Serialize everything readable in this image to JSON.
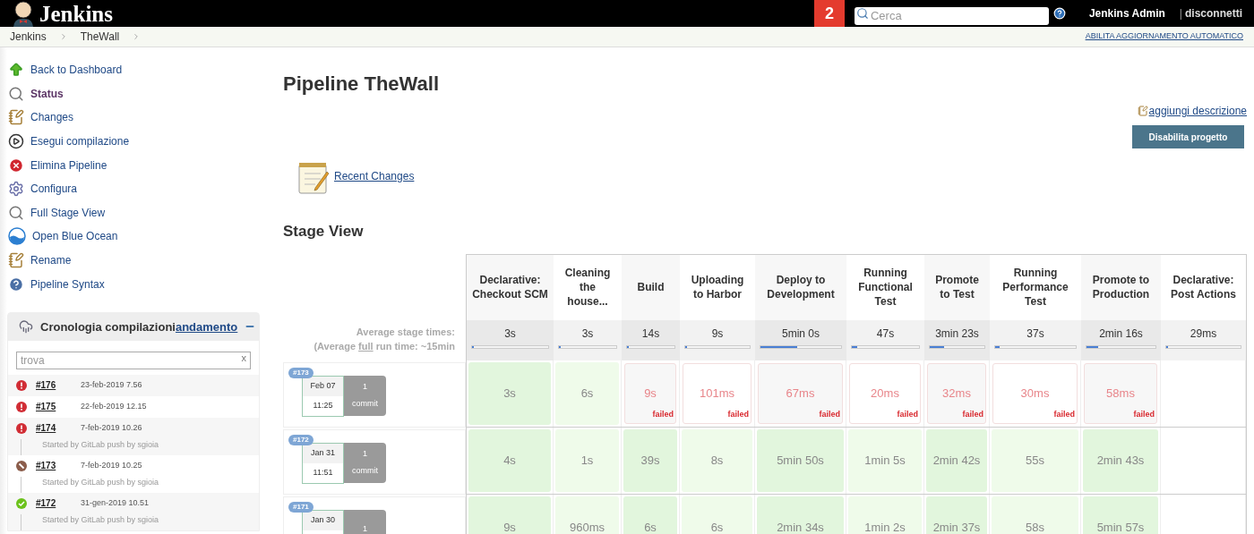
{
  "header": {
    "logo_text": "Jenkins",
    "notification_count": "2",
    "search": {
      "placeholder": "Cerca"
    },
    "user": "Jenkins Admin",
    "separator": "|",
    "logout": "disconnetti"
  },
  "breadcrumbs": [
    {
      "label": "Jenkins"
    },
    {
      "label": "TheWall"
    }
  ],
  "auto_refresh": "ABILITA AGGIORNAMENTO AUTOMATICO",
  "sidebar": {
    "items": [
      {
        "kind": "up",
        "label": "Back to Dashboard",
        "selected": false
      },
      {
        "kind": "search",
        "label": "Status",
        "selected": true
      },
      {
        "kind": "notepad",
        "label": "Changes",
        "selected": false
      },
      {
        "kind": "play",
        "label": "Esegui compilazione",
        "selected": false
      },
      {
        "kind": "delete",
        "label": "Elimina Pipeline",
        "selected": false
      },
      {
        "kind": "gear",
        "label": "Configura",
        "selected": false
      },
      {
        "kind": "search",
        "label": "Full Stage View",
        "selected": false
      },
      {
        "kind": "ocean",
        "label": "Open Blue Ocean",
        "selected": false
      },
      {
        "kind": "notepad",
        "label": "Rename",
        "selected": false
      },
      {
        "kind": "help",
        "label": "Pipeline Syntax",
        "selected": false
      }
    ]
  },
  "build_history": {
    "title": "Cronologia compilazioni",
    "trend_link": "andamento",
    "search": {
      "placeholder": "trova",
      "clear": "x"
    },
    "builds": [
      {
        "kind": "fail",
        "number": "#176",
        "date": "23-feb-2019 7.56"
      },
      {
        "kind": "fail",
        "number": "#175",
        "date": "22-feb-2019 12.15"
      },
      {
        "kind": "fail",
        "number": "#174",
        "date": "7-feb-2019 10.26",
        "cause": "Started by GitLab push by sgioia"
      },
      {
        "kind": "stopped",
        "number": "#173",
        "date": "7-feb-2019 10.25",
        "cause": "Started by GitLab push by sgioia"
      },
      {
        "kind": "pass",
        "number": "#172",
        "date": "31-gen-2019 10.51",
        "cause": "Started by GitLab push by sgioia"
      }
    ]
  },
  "main": {
    "title": "Pipeline TheWall",
    "add_description": "aggiungi descrizione",
    "disable_button": "Disabilita progetto",
    "recent_changes": "Recent Changes",
    "stage_view_title": "Stage View",
    "avg_label": "Average stage times:",
    "avg_full_prefix": "(Average ",
    "avg_full_word": "full",
    "avg_full_suffix": " run time: ~15min"
  },
  "stages": [
    {
      "name": "Declarative: Checkout SCM",
      "average": "3s",
      "level": 0.02
    },
    {
      "name": "Cleaning the house...",
      "average": "3s",
      "level": 0.02
    },
    {
      "name": "Build",
      "average": "14s",
      "level": 0.03
    },
    {
      "name": "Uploading to Harbor",
      "average": "9s",
      "level": 0.03
    },
    {
      "name": "Deploy to Development",
      "average": "5min 0s",
      "level": 0.45
    },
    {
      "name": "Running Functional Test",
      "average": "47s",
      "level": 0.08
    },
    {
      "name": "Promote to Test",
      "average": "3min 23s",
      "level": 0.27
    },
    {
      "name": "Running Performance Test",
      "average": "37s",
      "level": 0.06
    },
    {
      "name": "Promote to Production",
      "average": "2min 16s",
      "level": 0.17
    },
    {
      "name": "Declarative: Post Actions",
      "average": "29ms",
      "level": 0.01
    }
  ],
  "runs": [
    {
      "number": "#173",
      "date": "Feb 07",
      "time": "11:25",
      "commits": "1",
      "commits_label": "commit",
      "cells": [
        {
          "kind": "pass",
          "duration": "3s"
        },
        {
          "kind": "pass",
          "duration": "6s"
        },
        {
          "kind": "fail",
          "duration": "9s",
          "label": "failed"
        },
        {
          "kind": "fail",
          "duration": "101ms",
          "label": "failed"
        },
        {
          "kind": "fail",
          "duration": "67ms",
          "label": "failed"
        },
        {
          "kind": "fail",
          "duration": "20ms",
          "label": "failed"
        },
        {
          "kind": "fail",
          "duration": "32ms",
          "label": "failed"
        },
        {
          "kind": "fail",
          "duration": "30ms",
          "label": "failed"
        },
        {
          "kind": "fail",
          "duration": "58ms",
          "label": "failed"
        },
        {
          "kind": "empty"
        }
      ]
    },
    {
      "number": "#172",
      "date": "Jan 31",
      "time": "11:51",
      "commits": "1",
      "commits_label": "commit",
      "cells": [
        {
          "kind": "pass",
          "duration": "4s"
        },
        {
          "kind": "pass",
          "duration": "1s"
        },
        {
          "kind": "pass",
          "duration": "39s"
        },
        {
          "kind": "pass",
          "duration": "8s"
        },
        {
          "kind": "pass",
          "duration": "5min 50s"
        },
        {
          "kind": "pass",
          "duration": "1min 5s"
        },
        {
          "kind": "pass",
          "duration": "2min 42s"
        },
        {
          "kind": "pass",
          "duration": "55s"
        },
        {
          "kind": "pass",
          "duration": "2min 43s"
        },
        {
          "kind": "empty"
        }
      ]
    },
    {
      "number": "#171",
      "date": "Jan 30",
      "commits": "1",
      "cells": [
        {
          "kind": "pass",
          "duration": "9s"
        },
        {
          "kind": "pass",
          "duration": "960ms"
        },
        {
          "kind": "pass",
          "duration": "6s"
        },
        {
          "kind": "pass",
          "duration": "6s"
        },
        {
          "kind": "pass",
          "duration": "2min 34s"
        },
        {
          "kind": "pass",
          "duration": "1min 2s"
        },
        {
          "kind": "pass",
          "duration": "2min 37s"
        },
        {
          "kind": "pass",
          "duration": "58s"
        },
        {
          "kind": "pass",
          "duration": "5min 57s"
        },
        {
          "kind": "empty"
        }
      ]
    }
  ]
}
